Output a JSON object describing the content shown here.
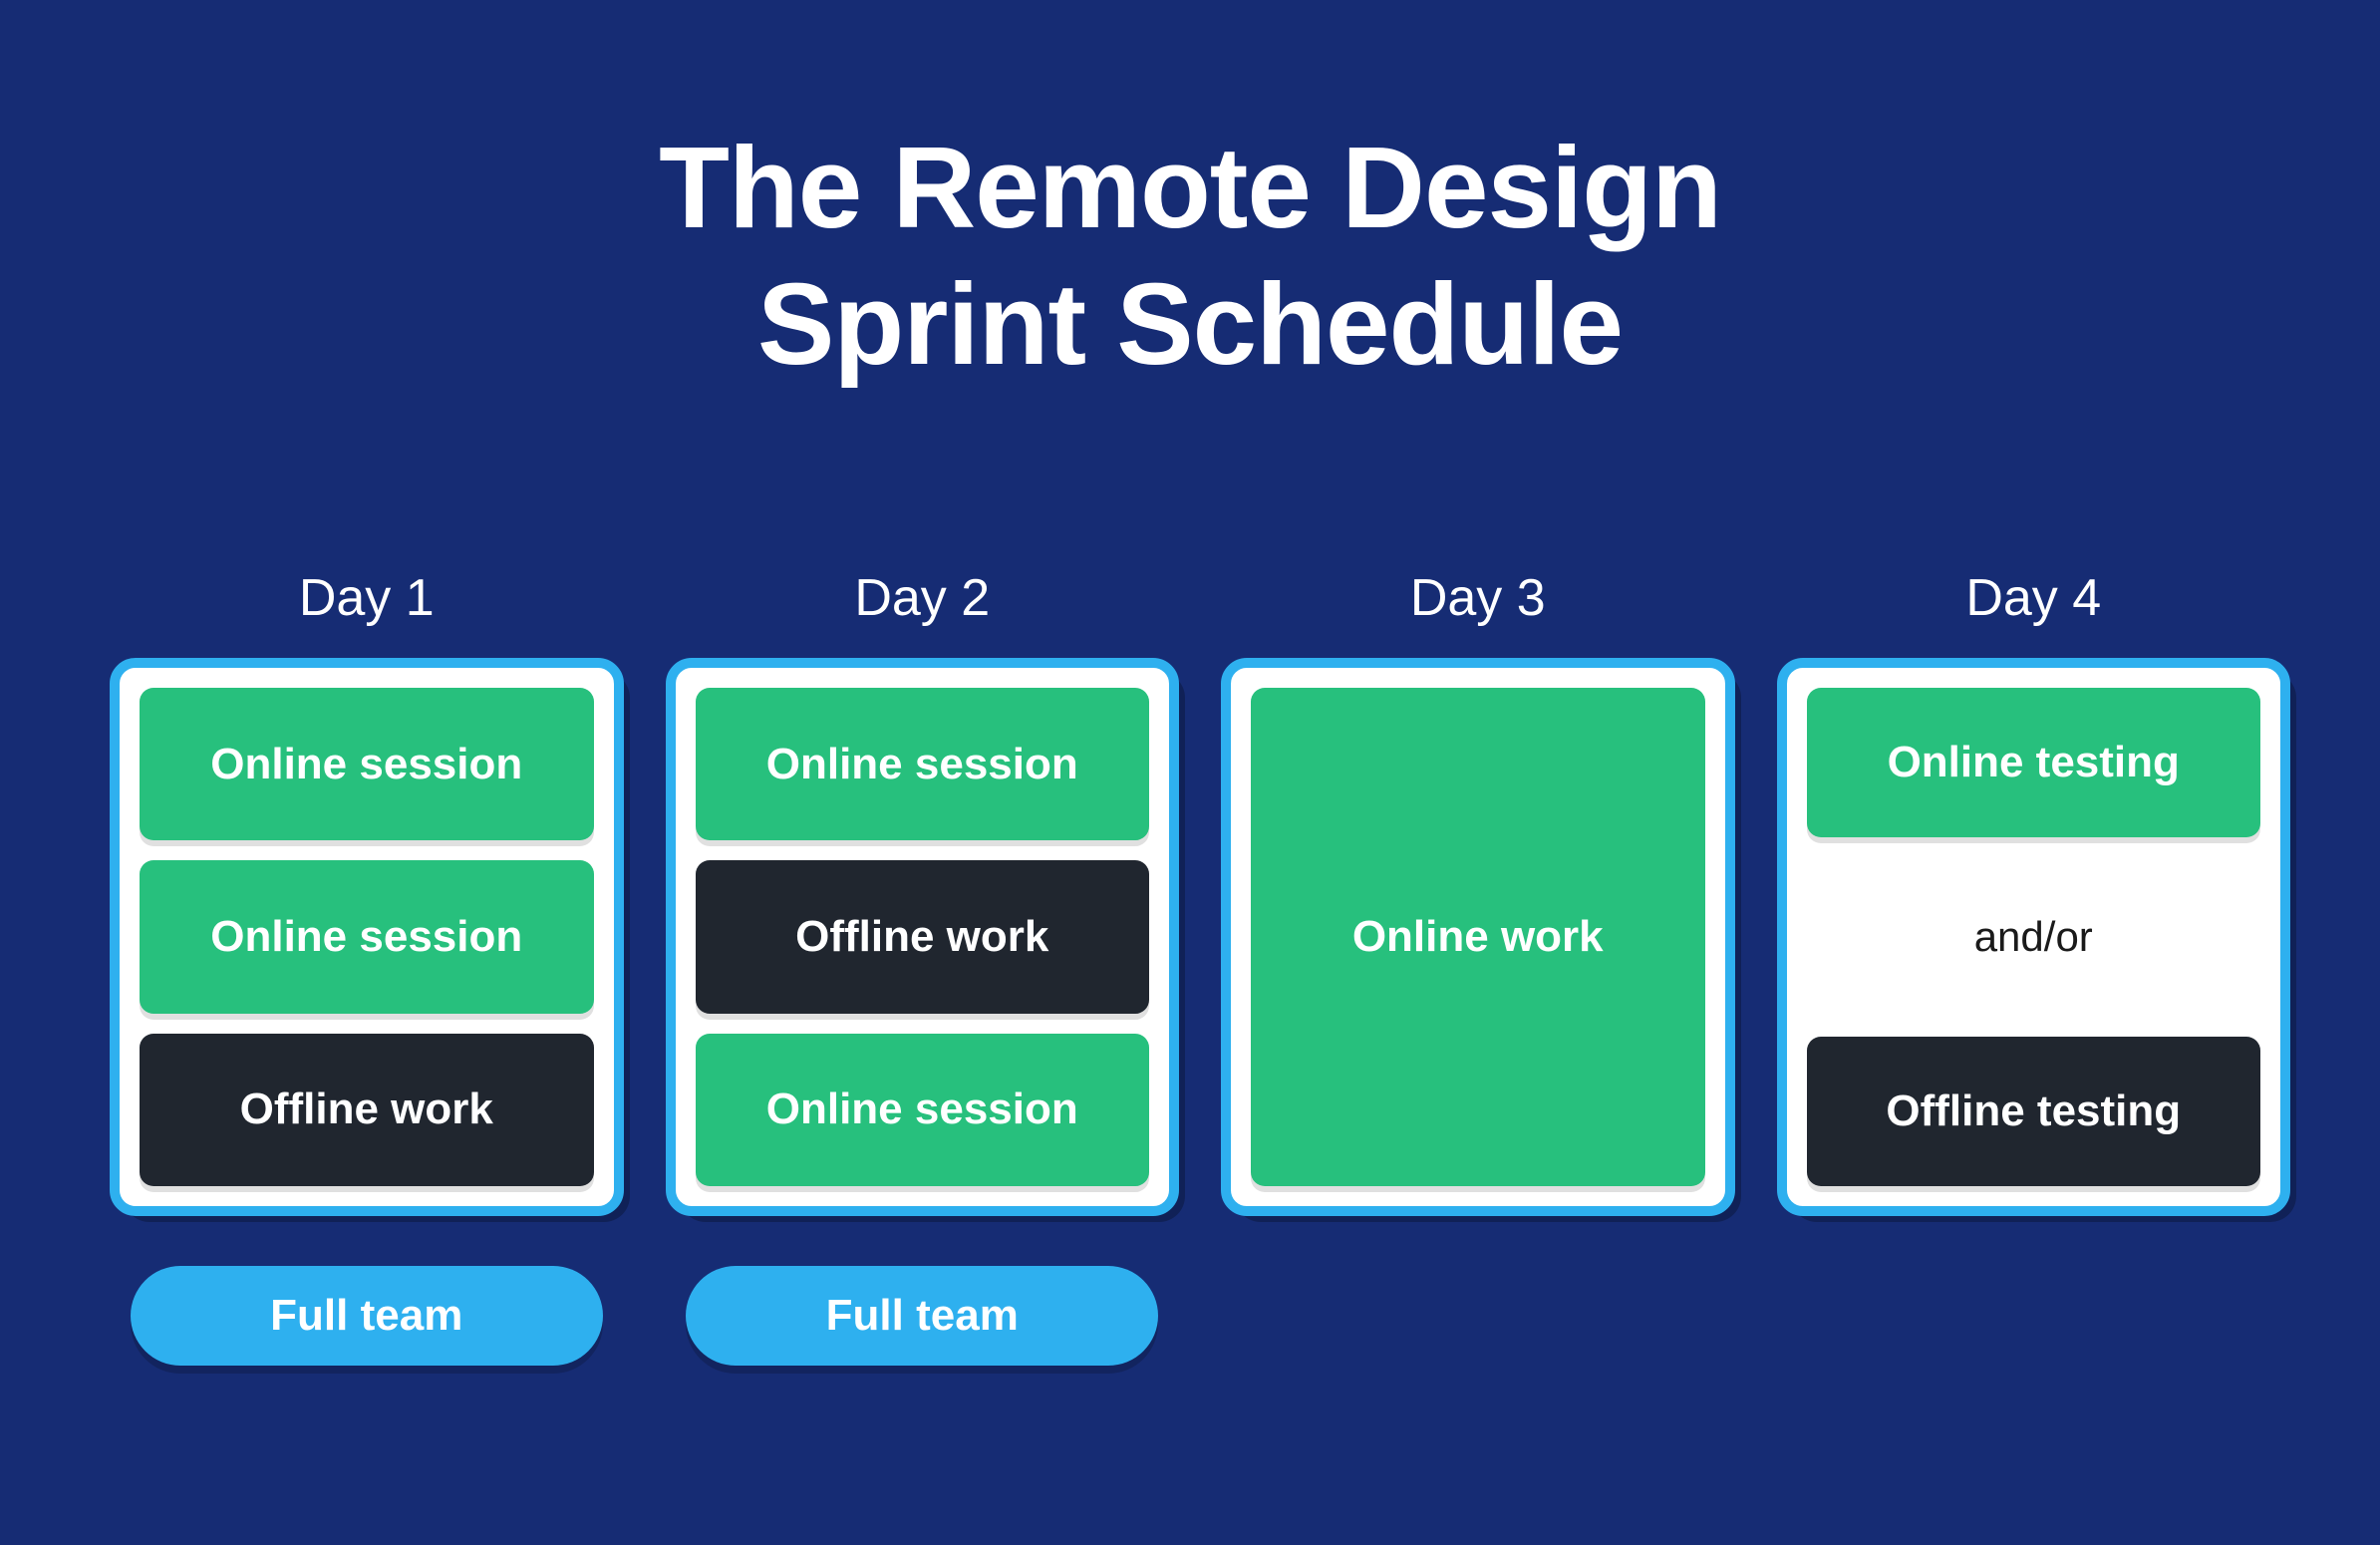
{
  "title_line1": "The Remote Design",
  "title_line2": "Sprint Schedule",
  "colors": {
    "background": "#162c74",
    "card_border": "#2eb0ef",
    "card_bg": "#ffffff",
    "green": "#27c07d",
    "dark": "#20262f",
    "pill": "#2eb0ef"
  },
  "days": {
    "d1": {
      "label": "Day 1",
      "block1": "Online session",
      "block2": "Online session",
      "block3": "Offline work",
      "pill": "Full team"
    },
    "d2": {
      "label": "Day 2",
      "block1": "Online session",
      "block2": "Offline work",
      "block3": "Online session",
      "pill": "Full team"
    },
    "d3": {
      "label": "Day 3",
      "block1": "Online work"
    },
    "d4": {
      "label": "Day 4",
      "block1": "Online testing",
      "between": "and/or",
      "block2": "Offline testing"
    }
  }
}
